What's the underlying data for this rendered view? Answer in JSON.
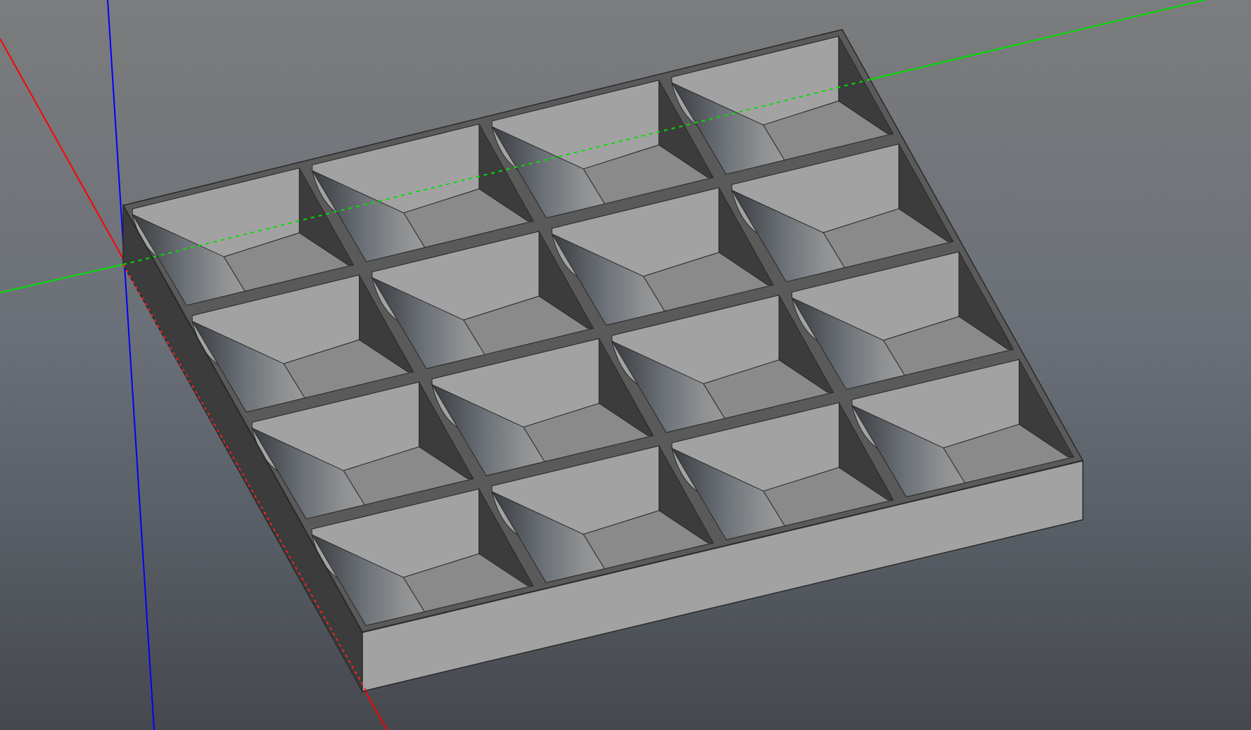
{
  "viewport": {
    "background_top": "#7b7c7d",
    "background_bottom": "#45484d"
  },
  "axes": {
    "x_color": "#ff0000",
    "y_color": "#00e000",
    "z_color": "#0000ff"
  },
  "model": {
    "type": "compartment-tray",
    "rows": 4,
    "cols": 4,
    "face_light": "#a2a2a2",
    "face_mid": "#8a8a8a",
    "face_dark": "#3c3c3c",
    "edge": "#2a2a2a"
  }
}
